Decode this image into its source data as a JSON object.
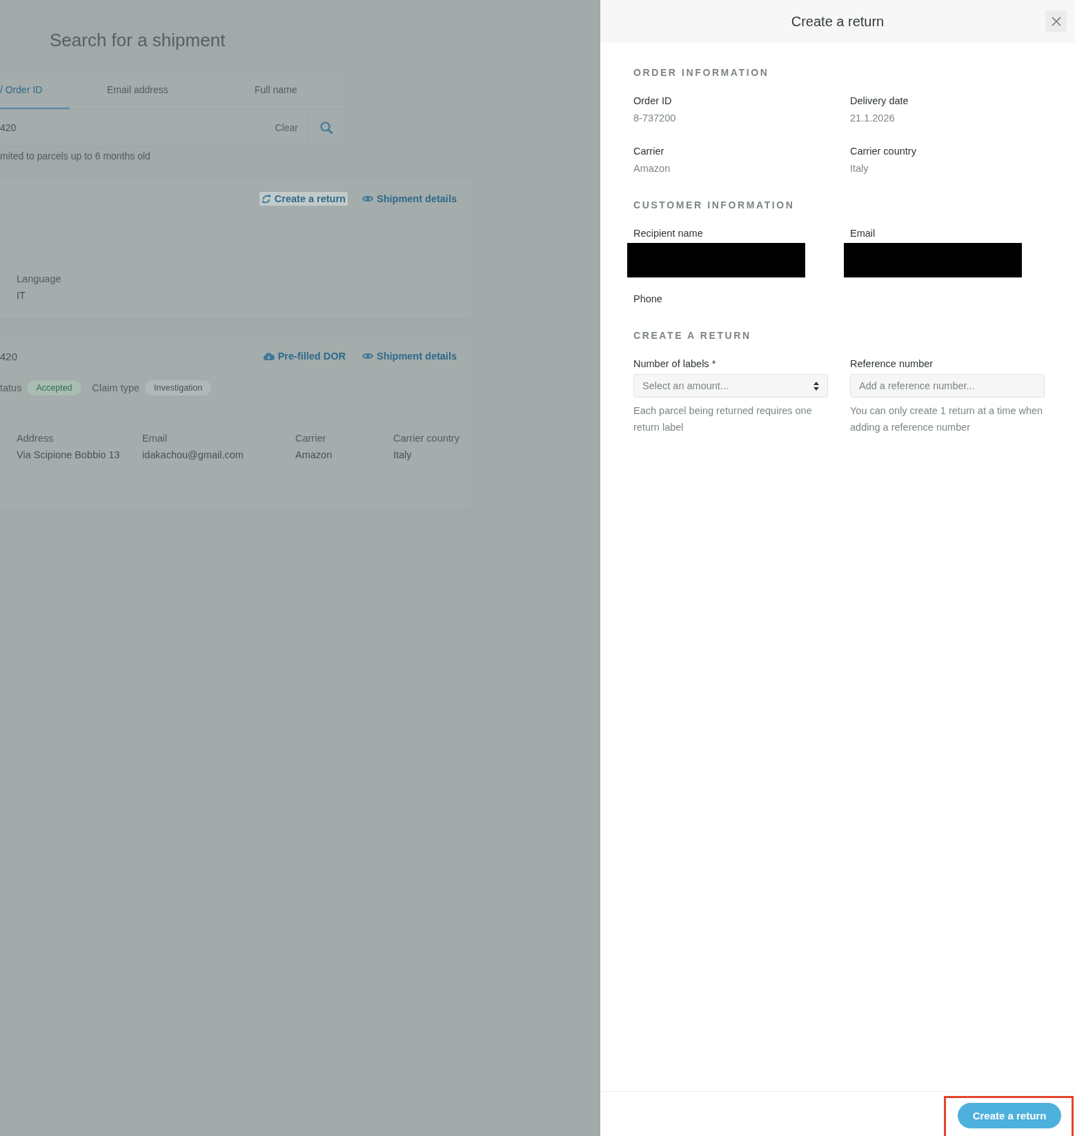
{
  "background_page": {
    "title": "Search for a shipment",
    "search_tabs": [
      {
        "label": "/ Order ID",
        "selected": true
      },
      {
        "label": "Email address",
        "selected": false
      },
      {
        "label": "Full name",
        "selected": false
      }
    ],
    "search_field": {
      "value": "420",
      "clear_label": "Clear"
    },
    "search_hint": "mited to parcels up to 6 months old",
    "results": [
      {
        "actions": [
          {
            "kind": "return",
            "label": "Create a return",
            "highlighted": true
          },
          {
            "kind": "details",
            "label": "Shipment details",
            "highlighted": false
          }
        ],
        "fields": [
          {
            "label": "Language",
            "value": "IT"
          }
        ]
      },
      {
        "title": "420",
        "actions": [
          {
            "kind": "download",
            "label": "Pre-filled DOR",
            "highlighted": false
          },
          {
            "kind": "details",
            "label": "Shipment details",
            "highlighted": false
          }
        ],
        "status_label": "tatus",
        "status": {
          "text": "Accepted",
          "kind": "success"
        },
        "claim_label": "Claim type",
        "claim": {
          "text": "Investigation",
          "kind": "neutral"
        },
        "fields": [
          {
            "label": "Address",
            "value": "Via Scipione Bobbio 13"
          },
          {
            "label": "Email",
            "value": "idakachou@gmail.com"
          },
          {
            "label": "Carrier",
            "value": "Amazon"
          },
          {
            "label": "Carrier country",
            "value": "Italy"
          }
        ]
      }
    ]
  },
  "drawer": {
    "title": "Create a return",
    "sections": [
      {
        "heading": "ORDER INFORMATION",
        "fields": [
          {
            "label": "Order ID",
            "value": "8-737200"
          },
          {
            "label": "Delivery date",
            "value": "21.1.2026"
          },
          {
            "label": "Carrier",
            "value": "Amazon"
          },
          {
            "label": "Carrier country",
            "value": "Italy"
          }
        ]
      },
      {
        "heading": "CUSTOMER INFORMATION",
        "fields": [
          {
            "label": "Recipient name",
            "redacted": true
          },
          {
            "label": "Email",
            "redacted": true
          },
          {
            "label": "Phone",
            "redacted": false
          }
        ]
      },
      {
        "heading": "CREATE A RETURN",
        "inputs": [
          {
            "kind": "select",
            "label": "Number of labels *",
            "placeholder": "Select an amount...",
            "hint": "Each parcel being returned requires one return label"
          },
          {
            "kind": "text",
            "label": "Reference number",
            "placeholder": "Add a reference number...",
            "hint": "You can only create 1 return at a time when adding a reference number"
          }
        ]
      }
    ],
    "footer": {
      "button": "Create a return",
      "highlighted": true
    }
  }
}
